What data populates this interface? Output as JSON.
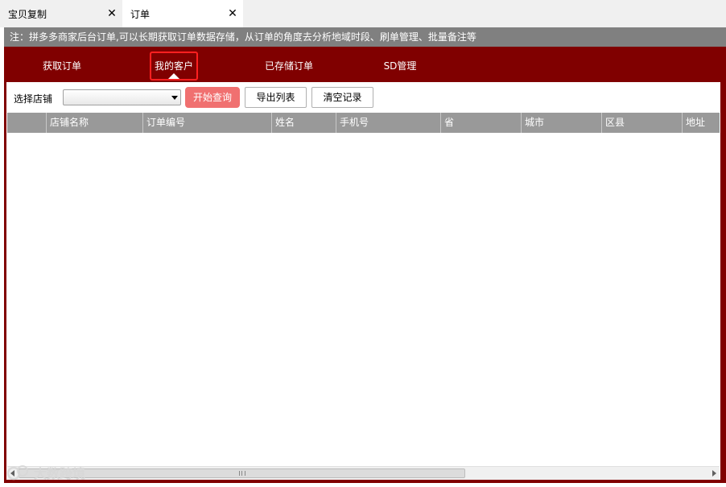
{
  "tabs": [
    {
      "label": "宝贝复制",
      "close": "✕"
    },
    {
      "label": "订单",
      "close": "✕"
    }
  ],
  "notice": "注：拼多多商家后台订单,可以长期获取订单数据存储，从订单的角度去分析地域时段、刷单管理、批量备注等",
  "nav": {
    "items": [
      "获取订单",
      "我的客户",
      "已存储订单",
      "SD管理"
    ],
    "active_index": 1
  },
  "toolbar": {
    "store_label": "选择店铺",
    "store_value": "",
    "query_button": "开始查询",
    "export_button": "导出列表",
    "clear_button": "清空记录"
  },
  "table": {
    "columns": [
      "",
      "店铺名称",
      "订单编号",
      "姓名",
      "手机号",
      "省",
      "城市",
      "区县",
      "地址"
    ],
    "rows": []
  },
  "watermark": "大数跨境",
  "colors": {
    "frame": "#800000",
    "notice_bg": "#808080",
    "header_bg": "#999999",
    "query_button": "#f07070",
    "active_highlight": "#ff2020"
  }
}
